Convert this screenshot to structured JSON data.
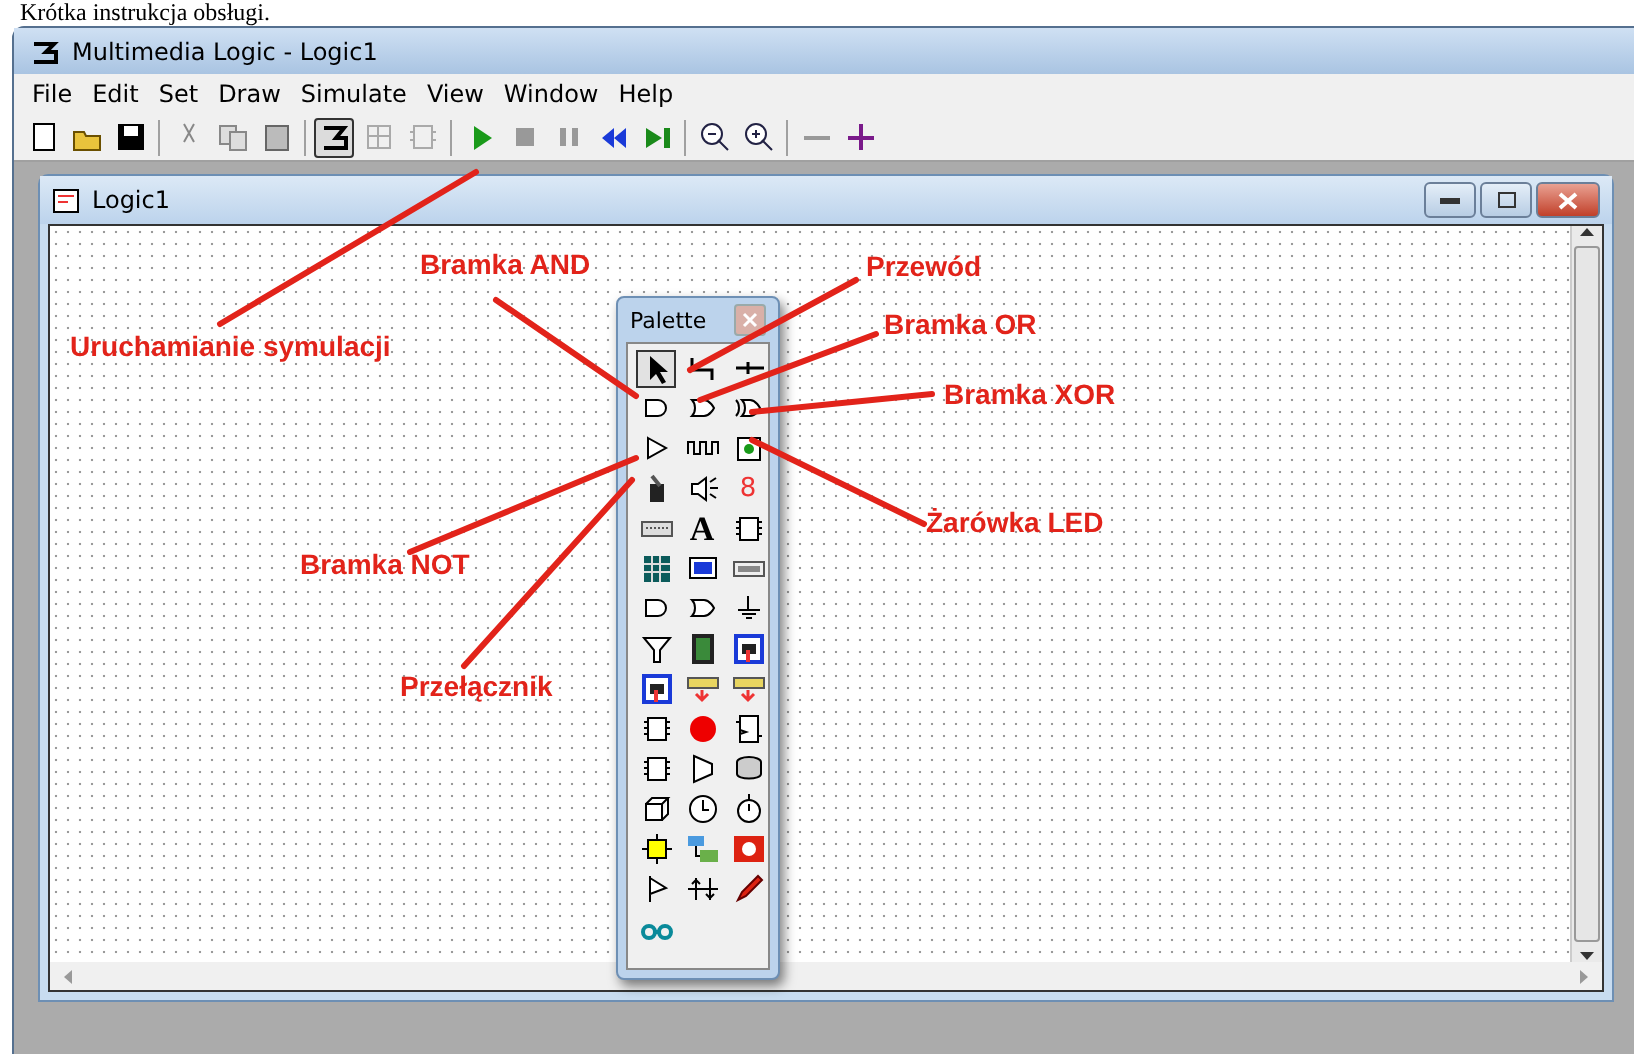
{
  "heading": "Krótka instrukcja obsługi.",
  "window": {
    "title": "Multimedia Logic - Logic1"
  },
  "menu": [
    "File",
    "Edit",
    "Set",
    "Draw",
    "Simulate",
    "View",
    "Window",
    "Help"
  ],
  "toolbar": [
    {
      "kind": "new",
      "selected": false
    },
    {
      "kind": "open",
      "selected": false
    },
    {
      "kind": "save",
      "selected": false
    },
    {
      "kind": "sep"
    },
    {
      "kind": "cut",
      "selected": false
    },
    {
      "kind": "copy",
      "selected": false
    },
    {
      "kind": "paste",
      "selected": false
    },
    {
      "kind": "sep"
    },
    {
      "kind": "draw-mode",
      "selected": true
    },
    {
      "kind": "grid",
      "selected": false
    },
    {
      "kind": "chip",
      "selected": false
    },
    {
      "kind": "sep"
    },
    {
      "kind": "run",
      "selected": false
    },
    {
      "kind": "stop",
      "selected": false
    },
    {
      "kind": "pause",
      "selected": false
    },
    {
      "kind": "rewind",
      "selected": false
    },
    {
      "kind": "step",
      "selected": false
    },
    {
      "kind": "sep"
    },
    {
      "kind": "zoom-out",
      "selected": false
    },
    {
      "kind": "zoom-in",
      "selected": false
    },
    {
      "kind": "sep"
    },
    {
      "kind": "minus",
      "selected": false
    },
    {
      "kind": "plus",
      "selected": false
    }
  ],
  "child_window": {
    "title": "Logic1"
  },
  "palette": {
    "title": "Palette",
    "tools": [
      {
        "kind": "pointer",
        "selected": true
      },
      {
        "kind": "wire",
        "selected": false
      },
      {
        "kind": "pin",
        "selected": false
      },
      {
        "kind": "and",
        "selected": false
      },
      {
        "kind": "or",
        "selected": false
      },
      {
        "kind": "xor",
        "selected": false
      },
      {
        "kind": "not",
        "selected": false
      },
      {
        "kind": "pulse",
        "selected": false
      },
      {
        "kind": "led",
        "selected": false
      },
      {
        "kind": "switch",
        "selected": false
      },
      {
        "kind": "speaker",
        "selected": false
      },
      {
        "kind": "glyph",
        "label": "8",
        "selected": false
      },
      {
        "kind": "keyboard",
        "selected": false
      },
      {
        "kind": "glyph-text",
        "label": "A",
        "selected": false
      },
      {
        "kind": "chip",
        "selected": false
      },
      {
        "kind": "keypad",
        "selected": false
      },
      {
        "kind": "screen",
        "selected": false
      },
      {
        "kind": "display",
        "selected": false
      },
      {
        "kind": "and",
        "selected": false
      },
      {
        "kind": "or",
        "selected": false
      },
      {
        "kind": "ground",
        "selected": false
      },
      {
        "kind": "funnel",
        "selected": false
      },
      {
        "kind": "film",
        "selected": false
      },
      {
        "kind": "device",
        "selected": false
      },
      {
        "kind": "device",
        "selected": false
      },
      {
        "kind": "strip",
        "selected": false
      },
      {
        "kind": "strip",
        "selected": false
      },
      {
        "kind": "chip",
        "selected": false
      },
      {
        "kind": "stop",
        "selected": false
      },
      {
        "kind": "flipflop",
        "selected": false
      },
      {
        "kind": "chip",
        "selected": false
      },
      {
        "kind": "mux",
        "selected": false
      },
      {
        "kind": "drum",
        "selected": false
      },
      {
        "kind": "cube",
        "selected": false
      },
      {
        "kind": "clock",
        "selected": false
      },
      {
        "kind": "stopwatch",
        "selected": false
      },
      {
        "kind": "node",
        "selected": false
      },
      {
        "kind": "network",
        "selected": false
      },
      {
        "kind": "redbox",
        "selected": false
      },
      {
        "kind": "flag",
        "selected": false
      },
      {
        "kind": "bus",
        "selected": false
      },
      {
        "kind": "pen",
        "selected": false
      },
      {
        "kind": "glasses",
        "selected": false
      }
    ]
  },
  "annotations": [
    "Bramka AND",
    "Przewód",
    "Uruchamianie symulacji",
    "Bramka OR",
    "Bramka XOR",
    "Żarówka LED",
    "Bramka NOT",
    "Przełącznik"
  ]
}
